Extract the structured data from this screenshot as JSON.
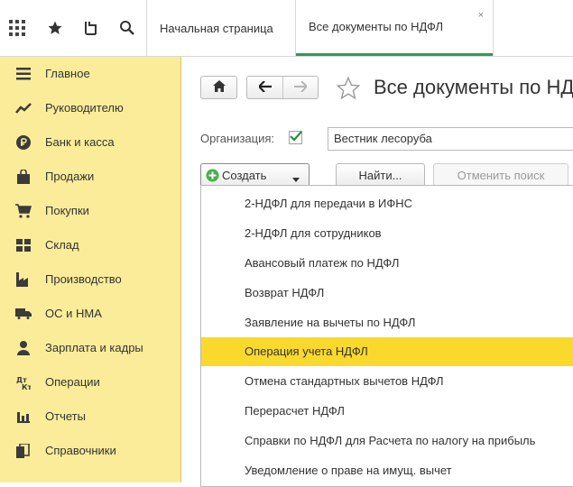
{
  "topbar": {
    "icons": [
      "apps-grid-icon",
      "favorites-star-icon",
      "history-icon",
      "search-icon"
    ],
    "tabs": [
      {
        "label": "Начальная страница",
        "active": false
      },
      {
        "label": "Все документы по НДФЛ",
        "active": true,
        "close": "×"
      }
    ]
  },
  "sidebar": {
    "items": [
      {
        "label": "Главное",
        "icon": "menu-lines-icon"
      },
      {
        "label": "Руководителю",
        "icon": "trend-chart-icon"
      },
      {
        "label": "Банк и касса",
        "icon": "ruble-coin-icon"
      },
      {
        "label": "Продажи",
        "icon": "shopping-bag-icon"
      },
      {
        "label": "Покупки",
        "icon": "cart-icon"
      },
      {
        "label": "Склад",
        "icon": "warehouse-grid-icon"
      },
      {
        "label": "Производство",
        "icon": "factory-icon"
      },
      {
        "label": "ОС и НМА",
        "icon": "truck-icon"
      },
      {
        "label": "Зарплата и кадры",
        "icon": "person-icon"
      },
      {
        "label": "Операции",
        "icon": "debit-credit-icon"
      },
      {
        "label": "Отчеты",
        "icon": "bar-chart-icon"
      },
      {
        "label": "Справочники",
        "icon": "books-icon"
      }
    ]
  },
  "main": {
    "title": "Все документы по НДФЛ",
    "organization_label": "Организация:",
    "organization_checked": true,
    "organization_value": "Вестник лесоруба",
    "create_label": "Создать",
    "find_label": "Найти...",
    "cancel_search_label": "Отменить поиск",
    "dropdown": [
      "2-НДФЛ для передачи в ИФНС",
      "2-НДФЛ для сотрудников",
      "Авансовый платеж по НДФЛ",
      "Возврат НДФЛ",
      "Заявление на вычеты по НДФЛ",
      "Операция учета НДФЛ",
      "Отмена стандартных вычетов НДФЛ",
      "Перерасчет НДФЛ",
      "Справки по НДФЛ для Расчета по налогу на прибыль",
      "Уведомление о праве на имущ. вычет"
    ],
    "highlighted_item": "Операция учета НДФЛ",
    "colors": {
      "sidebar": "#fbec9a",
      "highlight": "#f9d92c",
      "active_tab_line": "#2d9a5a",
      "check": "#2e8b3e",
      "create_icon": "#4caf50"
    }
  }
}
